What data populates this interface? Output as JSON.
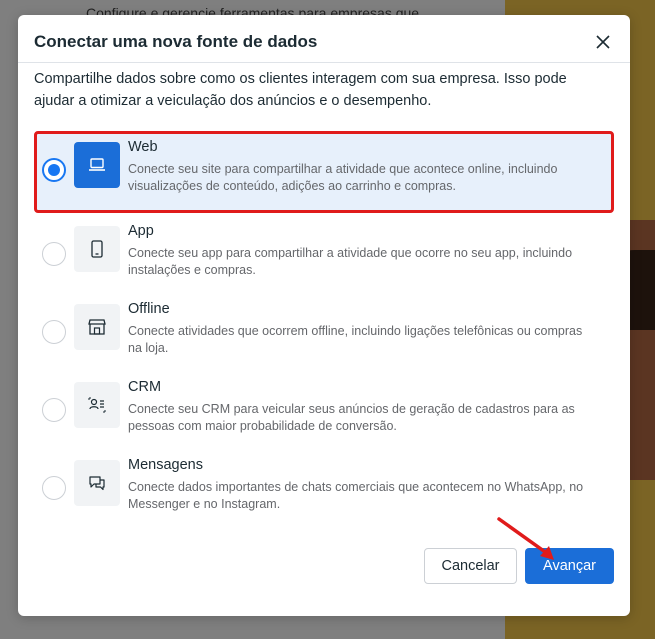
{
  "background": {
    "top_text": "Configure e gerencie ferramentas para empresas que"
  },
  "dialog": {
    "title": "Conectar uma nova fonte de dados",
    "close_icon": "close-icon",
    "description": "Compartilhe dados sobre como os clientes interagem com sua empresa. Isso pode ajudar a otimizar a veiculação dos anúncios e o desempenho.",
    "options": [
      {
        "title": "Web",
        "description": "Conecte seu site para compartilhar a atividade que acontece online, incluindo visualizações de conteúdo, adições ao carrinho e compras.",
        "icon": "laptop-icon",
        "selected": true
      },
      {
        "title": "App",
        "description": "Conecte seu app para compartilhar a atividade que ocorre no seu app, incluindo instalações e compras.",
        "icon": "phone-icon",
        "selected": false
      },
      {
        "title": "Offline",
        "description": "Conecte atividades que ocorrem offline, incluindo ligações telefônicas ou compras na loja.",
        "icon": "store-icon",
        "selected": false
      },
      {
        "title": "CRM",
        "description": "Conecte seu CRM para veicular seus anúncios de geração de cadastros para as pessoas com maior probabilidade de conversão.",
        "icon": "crm-icon",
        "selected": false
      },
      {
        "title": "Mensagens",
        "description": "Conecte dados importantes de chats comerciais que acontecem no WhatsApp, no Messenger e no Instagram.",
        "icon": "chat-icon",
        "selected": false
      }
    ],
    "cancel_label": "Cancelar",
    "next_label": "Avançar"
  },
  "colors": {
    "primary": "#1b6ed8",
    "highlight_border": "#e01b1b",
    "selected_bg": "#e7f0fb"
  }
}
